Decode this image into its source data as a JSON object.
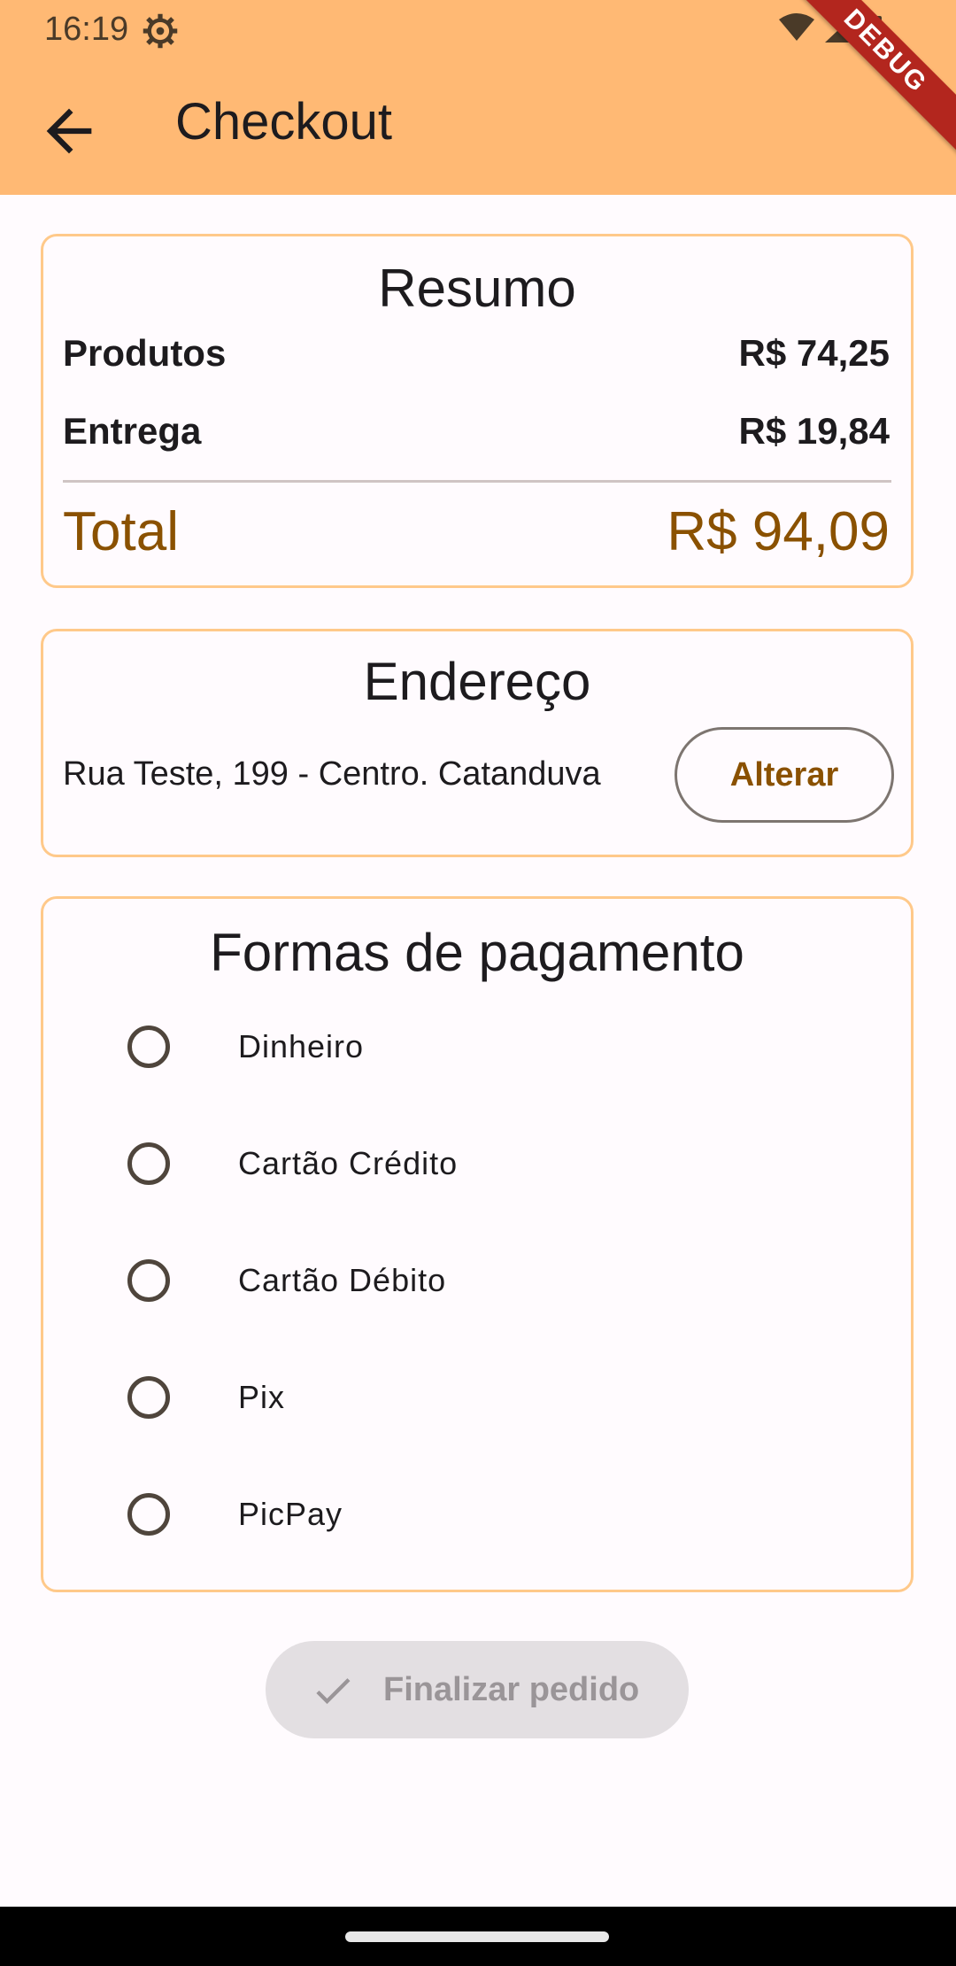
{
  "status_bar": {
    "time": "16:19",
    "icons": [
      "settings-icon",
      "wifi-icon",
      "signal-icon",
      "battery-icon"
    ]
  },
  "debug_banner": "DEBUG",
  "app_bar": {
    "title": "Checkout",
    "back_icon": "arrow-back-icon",
    "background": "#ffb974"
  },
  "summary": {
    "title": "Resumo",
    "products_label": "Produtos",
    "products_value": "R$ 74,25",
    "delivery_label": "Entrega",
    "delivery_value": "R$ 19,84",
    "total_label": "Total",
    "total_value": "R$ 94,09"
  },
  "address": {
    "title": "Endereço",
    "text": "Rua Teste, 199 - Centro. Catanduva",
    "change_button": "Alterar"
  },
  "payment": {
    "title": "Formas de pagamento",
    "options": [
      {
        "label": "Dinheiro",
        "selected": false
      },
      {
        "label": "Cartão Crédito",
        "selected": false
      },
      {
        "label": "Cartão Débito",
        "selected": false
      },
      {
        "label": "Pix",
        "selected": false
      },
      {
        "label": "PicPay",
        "selected": false
      }
    ]
  },
  "finish_button": {
    "label": "Finalizar pedido",
    "icon": "check-icon",
    "enabled": false
  },
  "colors": {
    "accent": "#8a5100",
    "card_border": "#ffc98a",
    "disabled_bg": "#e3dfe2"
  }
}
